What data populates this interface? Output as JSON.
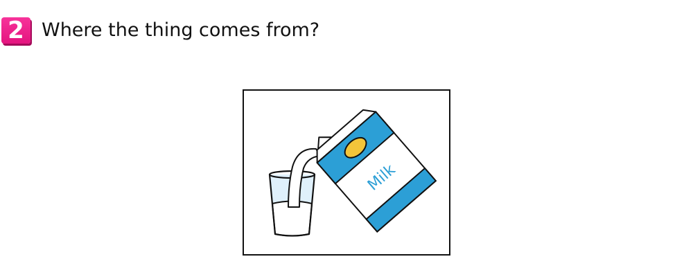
{
  "question": {
    "number": "2",
    "text": "Where the thing comes from?"
  },
  "illustration": {
    "carton_label": "Milk",
    "colors": {
      "carton_blue": "#2c9fd6",
      "carton_spot": "#f3c53a",
      "milk": "#ffffff",
      "glass_tint": "#dff0fb",
      "outline": "#111111",
      "badge_pink": "#ec1c86"
    }
  }
}
